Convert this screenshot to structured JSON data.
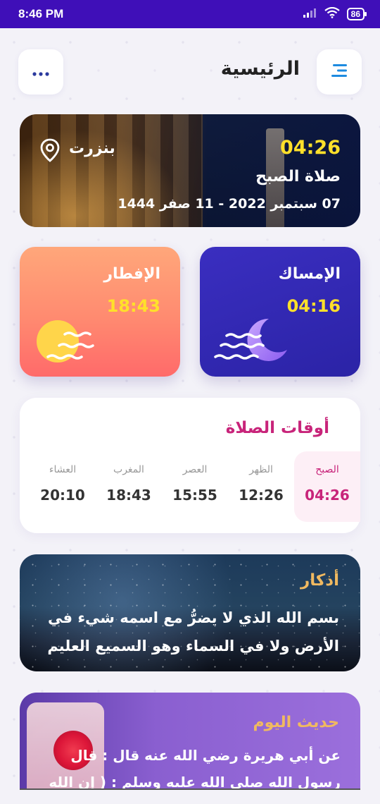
{
  "status_bar": {
    "time": "8:46 PM",
    "battery": "86"
  },
  "header": {
    "title": "الرئيسية"
  },
  "location_card": {
    "time": "04:26",
    "prayer_name": "صلاة الصبح",
    "date": "07 سبتمبر 2022  -  11 صفر 1444",
    "city": "بنزرت"
  },
  "imsak": {
    "title": "الإمساك",
    "time": "04:16"
  },
  "iftar": {
    "title": "الإفطار",
    "time": "18:43"
  },
  "prayer_times": {
    "title": "أوقات الصلاة",
    "items": [
      {
        "name": "الصبح",
        "time": "04:26"
      },
      {
        "name": "الظهر",
        "time": "12:26"
      },
      {
        "name": "العصر",
        "time": "15:55"
      },
      {
        "name": "المغرب",
        "time": "18:43"
      },
      {
        "name": "العشاء",
        "time": "20:10"
      }
    ]
  },
  "dhikr": {
    "title": "أذكار",
    "text": "بسم الله الذي لا يضرُّ مع اسمه شيء في الأرض ولا في السماء وهو السميع العليم"
  },
  "hadith": {
    "title": "حديث اليوم",
    "text": "عن أبي هريرة رضي الله عنه  قال : قال رسول الله صلى الله عليه وسلم : ( إن الله"
  },
  "colors": {
    "status_bar": "#3f0fb8",
    "accent_pink": "#c8247a",
    "time_yellow": "#ffe02a",
    "imsak_bg": "#2f26b0",
    "iftar_bg": "#ff8a70",
    "gold_title": "#f0b960"
  },
  "icons": [
    "wifi-icon",
    "signal-icon",
    "battery-icon",
    "more-dots-icon",
    "menu-icon",
    "location-pin-icon",
    "moon-waves-icon",
    "sun-waves-icon"
  ]
}
